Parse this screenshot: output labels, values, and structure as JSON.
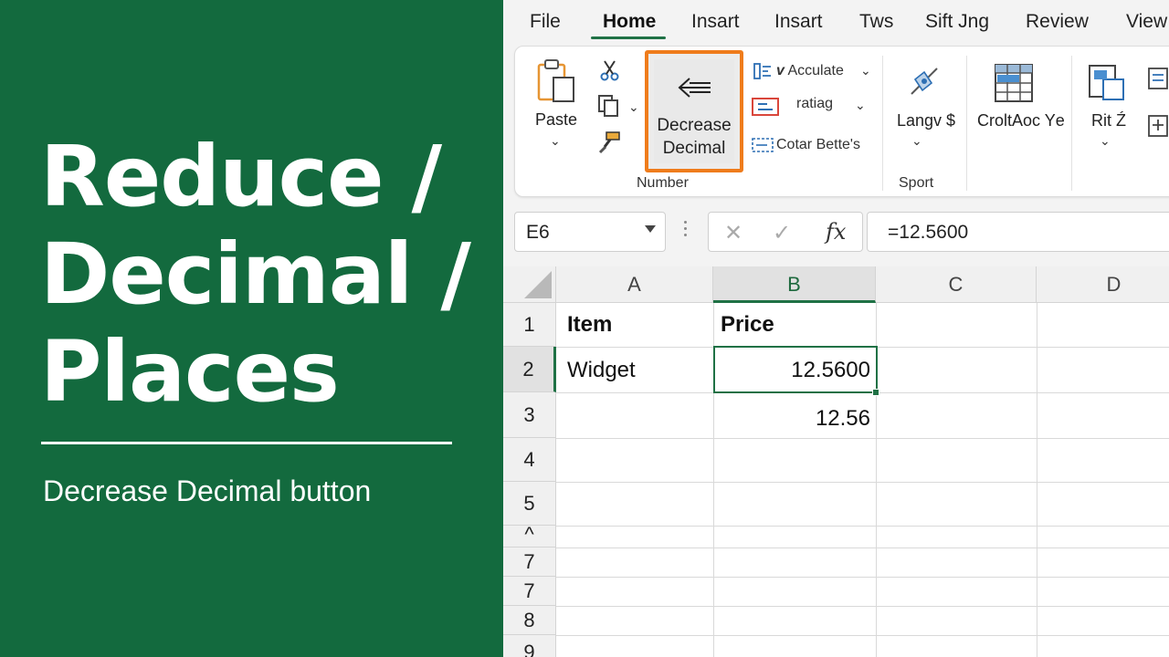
{
  "title_panel": {
    "lines": [
      "Reduce /",
      "Decimal /",
      "Places"
    ],
    "subtitle": "Decrease Decimal button",
    "background": "#136a3e"
  },
  "tabs": [
    "File",
    "Home",
    "Insart",
    "Insart",
    "Tws",
    "Sift Jng",
    "Review",
    "View"
  ],
  "active_tab": "Home",
  "ribbon": {
    "paste_label": "Paste",
    "decrease_decimal_label_1": "Decrease",
    "decrease_decimal_label_2": "Decimal",
    "accumulate_label": "Acculate",
    "ratio_label": "ratiag",
    "cotar_label": "Cotar Bette's",
    "number_group_label": "Number",
    "lang_label": "Langv $",
    "sport_group_label": "Sport",
    "croltoc_label": "CroltАoc Yе",
    "rit_label": "Rit Ź",
    "highlight_color": "#ef7c1c",
    "accent_color": "#1f7145"
  },
  "formula_bar": {
    "name_box": "E6",
    "formula": "=12.5600",
    "fx": "fx",
    "cancel": "✕",
    "enter": "✓"
  },
  "grid": {
    "columns": [
      "A",
      "B",
      "C",
      "D"
    ],
    "selected_column": "B",
    "rows": [
      "1",
      "2",
      "3",
      "4",
      "5",
      "^",
      "7",
      "7",
      "8",
      "9"
    ],
    "selected_row": "2",
    "cells": {
      "A1": "Item",
      "B1": "Price",
      "A2": "Widget",
      "B2": "12.5600",
      "B3": "12.56"
    }
  }
}
